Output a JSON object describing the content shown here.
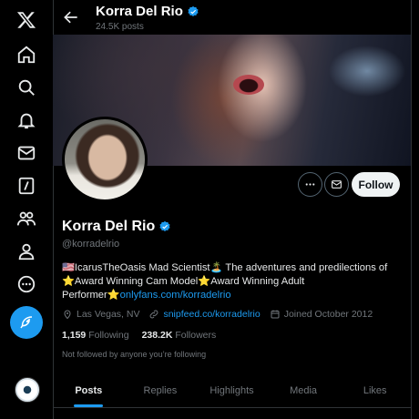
{
  "nav": {
    "items": [
      {
        "name": "x-logo-icon"
      },
      {
        "name": "home-icon"
      },
      {
        "name": "explore-icon"
      },
      {
        "name": "notifications-icon"
      },
      {
        "name": "messages-icon"
      },
      {
        "name": "grok-icon"
      },
      {
        "name": "communities-icon"
      },
      {
        "name": "profile-icon"
      },
      {
        "name": "more-icon"
      }
    ],
    "post_icon": "feather-icon",
    "accent": "#1d9bf0"
  },
  "header": {
    "name": "Korra Del Rio",
    "post_count": "24.5K posts"
  },
  "profile": {
    "name": "Korra Del Rio",
    "handle": "@korradelrio",
    "follow_label": "Follow",
    "bio": {
      "text1": "🇺🇸IcarusTheOasis Mad Scientist🏝️ The adventures and predilections of ⭐Award Winning Cam Model⭐Award Winning Adult Performer⭐",
      "link": "onlyfans.com/korradelrio"
    },
    "location": "Las Vegas, NV",
    "website": "snipfeed.co/korradelrio",
    "joined": "Joined October 2012",
    "following_count": "1,159",
    "following_label": "Following",
    "followers_count": "238.2K",
    "followers_label": "Followers",
    "not_followed": "Not followed by anyone you’re following"
  },
  "tabs": [
    "Posts",
    "Replies",
    "Highlights",
    "Media",
    "Likes"
  ],
  "active_tab": "Posts"
}
